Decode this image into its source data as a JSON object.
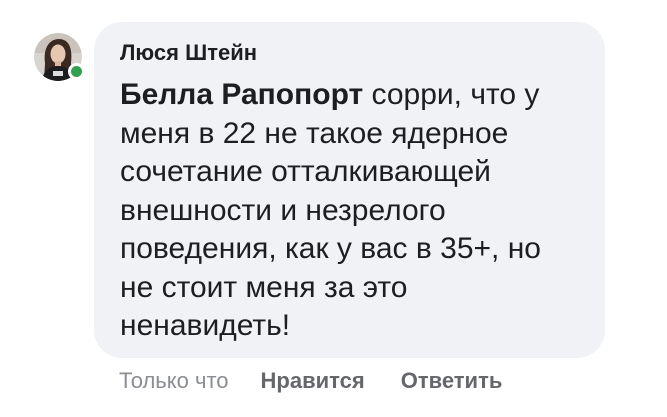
{
  "comment": {
    "author": "Люся Штейн",
    "mention": "Белла Рапопорт",
    "lines": [
      " сорри, что у",
      "меня в 22 не такое ядерное",
      "сочетание отталкивающей",
      "внешности и незрелого",
      "поведения, как у вас в 35+, но",
      "не стоит меня за это",
      "ненавидеть!"
    ],
    "online": true
  },
  "actions": {
    "timestamp": "Только что",
    "like_label": "Нравится",
    "reply_label": "Ответить"
  },
  "colors": {
    "bubble": "#f0f2f5",
    "text": "#1c1e21",
    "secondary": "#65676b",
    "presence": "#31a24c"
  }
}
